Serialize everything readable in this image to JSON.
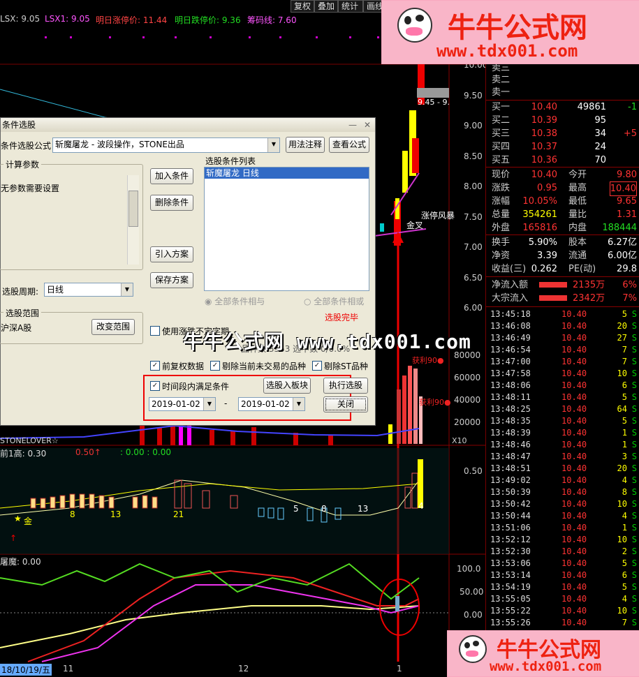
{
  "toolbar": {
    "b1": "复权",
    "b2": "叠加",
    "b3": "统计",
    "b4": "画线"
  },
  "indicators": {
    "lsx": "LSX: 9.05",
    "lsx1": "LSX1: 9.05",
    "up": "明日涨停价: 11.44",
    "down": "明日跌停价: 9.36",
    "chip": "筹码线: 7.60"
  },
  "watermark_top": {
    "title": "牛牛公式网",
    "url": "www.tdx001.com"
  },
  "watermark_bottom": {
    "title": "牛牛公式网",
    "url": "www.tdx001.com"
  },
  "center_watermark": "牛牛公式网 www.tdx001.com",
  "chart_labels": {
    "price_tag": "9.45 - 9.",
    "zt_wind": "涨停风暴",
    "jincha": "金叉",
    "sell_profit1": "获利90●",
    "sell_profit2": "获利90●",
    "stone": "STONELOVER☆",
    "sub_title": "前1高: 0.30",
    "sub_v1": "0.50↑",
    "sub_v2": ": 0.00 : 0.00",
    "gold": "金",
    "num_a": "8",
    "num_b": "13",
    "num_c": "21",
    "num_d": "5",
    "num_e": "8",
    "num_f": "13",
    "num_g": "4",
    "osc_title": "屠魔: 0.00",
    "x10": "X10",
    "date_l": "18/10/19/五",
    "x_11": "11",
    "x_12": "12",
    "x_1": "1"
  },
  "price_axis": [
    "10.00",
    "9.50",
    "9.00",
    "8.50",
    "8.00",
    "7.50",
    "7.00",
    "6.50",
    "6.00"
  ],
  "vol_axis": [
    "80000",
    "60000",
    "40000",
    "20000"
  ],
  "sub_axis": [
    "0.50"
  ],
  "osc_axis": [
    "100.0",
    "50.00",
    "0.00"
  ],
  "orderbook": {
    "asks": [
      {
        "l": "卖三"
      },
      {
        "l": "卖二"
      },
      {
        "l": "卖一"
      }
    ],
    "bids": [
      {
        "l": "买一",
        "p": "10.40",
        "v": "49861",
        "d": "-1"
      },
      {
        "l": "买二",
        "p": "10.39",
        "v": "95",
        "d": ""
      },
      {
        "l": "买三",
        "p": "10.38",
        "v": "34",
        "d": "+5"
      },
      {
        "l": "买四",
        "p": "10.37",
        "v": "24",
        "d": ""
      },
      {
        "l": "买五",
        "p": "10.36",
        "v": "70",
        "d": ""
      }
    ]
  },
  "quote": [
    {
      "a": "现价",
      "av": "10.40",
      "b": "今开",
      "bv": "9.80"
    },
    {
      "a": "涨跌",
      "av": "0.95",
      "b": "最高",
      "bv": "10.40"
    },
    {
      "a": "涨幅",
      "av": "10.05%",
      "b": "最低",
      "bv": "9.65"
    },
    {
      "a": "总量",
      "av": "354261",
      "b": "量比",
      "bv": "1.31"
    },
    {
      "a": "外盘",
      "av": "165816",
      "b": "内盘",
      "bv": "188444"
    }
  ],
  "fund": [
    {
      "a": "换手",
      "av": "5.90%",
      "b": "股本",
      "bv": "6.27亿"
    },
    {
      "a": "净资",
      "av": "3.39",
      "b": "流通",
      "bv": "6.00亿"
    },
    {
      "a": "收益(三)",
      "av": "0.262",
      "b": "PE(动)",
      "bv": "29.8"
    }
  ],
  "flow": [
    {
      "l": "净流入额",
      "v": "2135万",
      "p": "6%"
    },
    {
      "l": "大宗流入",
      "v": "2342万",
      "p": "7%"
    }
  ],
  "ticks": [
    {
      "t": "13:45:18",
      "p": "10.40",
      "a": "5",
      "s": "S"
    },
    {
      "t": "13:46:08",
      "p": "10.40",
      "a": "20",
      "s": "S"
    },
    {
      "t": "13:46:49",
      "p": "10.40",
      "a": "27",
      "s": "S"
    },
    {
      "t": "13:46:54",
      "p": "10.40",
      "a": "7",
      "s": "S"
    },
    {
      "t": "13:47:00",
      "p": "10.40",
      "a": "7",
      "s": "S"
    },
    {
      "t": "13:47:58",
      "p": "10.40",
      "a": "10",
      "s": "S"
    },
    {
      "t": "13:48:06",
      "p": "10.40",
      "a": "6",
      "s": "S"
    },
    {
      "t": "13:48:11",
      "p": "10.40",
      "a": "5",
      "s": "S"
    },
    {
      "t": "13:48:25",
      "p": "10.40",
      "a": "64",
      "s": "S"
    },
    {
      "t": "13:48:35",
      "p": "10.40",
      "a": "5",
      "s": "S"
    },
    {
      "t": "13:48:39",
      "p": "10.40",
      "a": "1",
      "s": "S"
    },
    {
      "t": "13:48:46",
      "p": "10.40",
      "a": "1",
      "s": "S"
    },
    {
      "t": "13:48:47",
      "p": "10.40",
      "a": "3",
      "s": "S"
    },
    {
      "t": "13:48:51",
      "p": "10.40",
      "a": "20",
      "s": "S"
    },
    {
      "t": "13:49:02",
      "p": "10.40",
      "a": "4",
      "s": "S"
    },
    {
      "t": "13:50:39",
      "p": "10.40",
      "a": "8",
      "s": "S"
    },
    {
      "t": "13:50:42",
      "p": "10.40",
      "a": "10",
      "s": "S"
    },
    {
      "t": "13:50:44",
      "p": "10.40",
      "a": "4",
      "s": "S"
    },
    {
      "t": "13:51:06",
      "p": "10.40",
      "a": "1",
      "s": "S"
    },
    {
      "t": "13:52:12",
      "p": "10.40",
      "a": "10",
      "s": "S"
    },
    {
      "t": "13:52:30",
      "p": "10.40",
      "a": "2",
      "s": "S"
    },
    {
      "t": "13:53:06",
      "p": "10.40",
      "a": "5",
      "s": "S"
    },
    {
      "t": "13:53:14",
      "p": "10.40",
      "a": "6",
      "s": "S"
    },
    {
      "t": "13:54:19",
      "p": "10.40",
      "a": "5",
      "s": "S"
    },
    {
      "t": "13:55:05",
      "p": "10.40",
      "a": "4",
      "s": "S"
    },
    {
      "t": "13:55:22",
      "p": "10.40",
      "a": "10",
      "s": "S"
    },
    {
      "t": "13:55:26",
      "p": "10.40",
      "a": "7",
      "s": "S"
    }
  ],
  "dialog": {
    "title": "条件选股",
    "formula_label": "条件选股公式",
    "formula_value": "斩魔屠龙    - 波段操作，STONE出品",
    "btn_usage": "用法注释",
    "btn_view": "查看公式",
    "params_title": "计算参数",
    "params_text": "无参数需要设置",
    "btn_add": "加入条件",
    "btn_del": "删除条件",
    "btn_import": "引入方案",
    "btn_save": "保存方案",
    "list_title": "选股条件列表",
    "list_item": "斩魔屠龙  日线",
    "period_label": "选股周期:",
    "period_value": "日线",
    "radio_and": "全部条件相与",
    "radio_or": "全部条件相或",
    "status": "选股完毕",
    "range_title": "选股范围",
    "range_value": "沪深A股",
    "btn_range": "改变范围",
    "chk_uncertain": "使用涨跌不定字期",
    "result_text": "品种数 3553  选中数 0/0.0%",
    "chk_adjust": "前复权数据",
    "chk_untraded": "剔除当前未交易的品种",
    "chk_st": "剔除ST品种",
    "chk_period": "时间段内满足条件",
    "btn_to_block": "选股入板块",
    "btn_exec": "执行选股",
    "btn_close": "关闭",
    "date_from": "2019-01-02",
    "dash": "-",
    "date_to": "2019-01-02"
  }
}
